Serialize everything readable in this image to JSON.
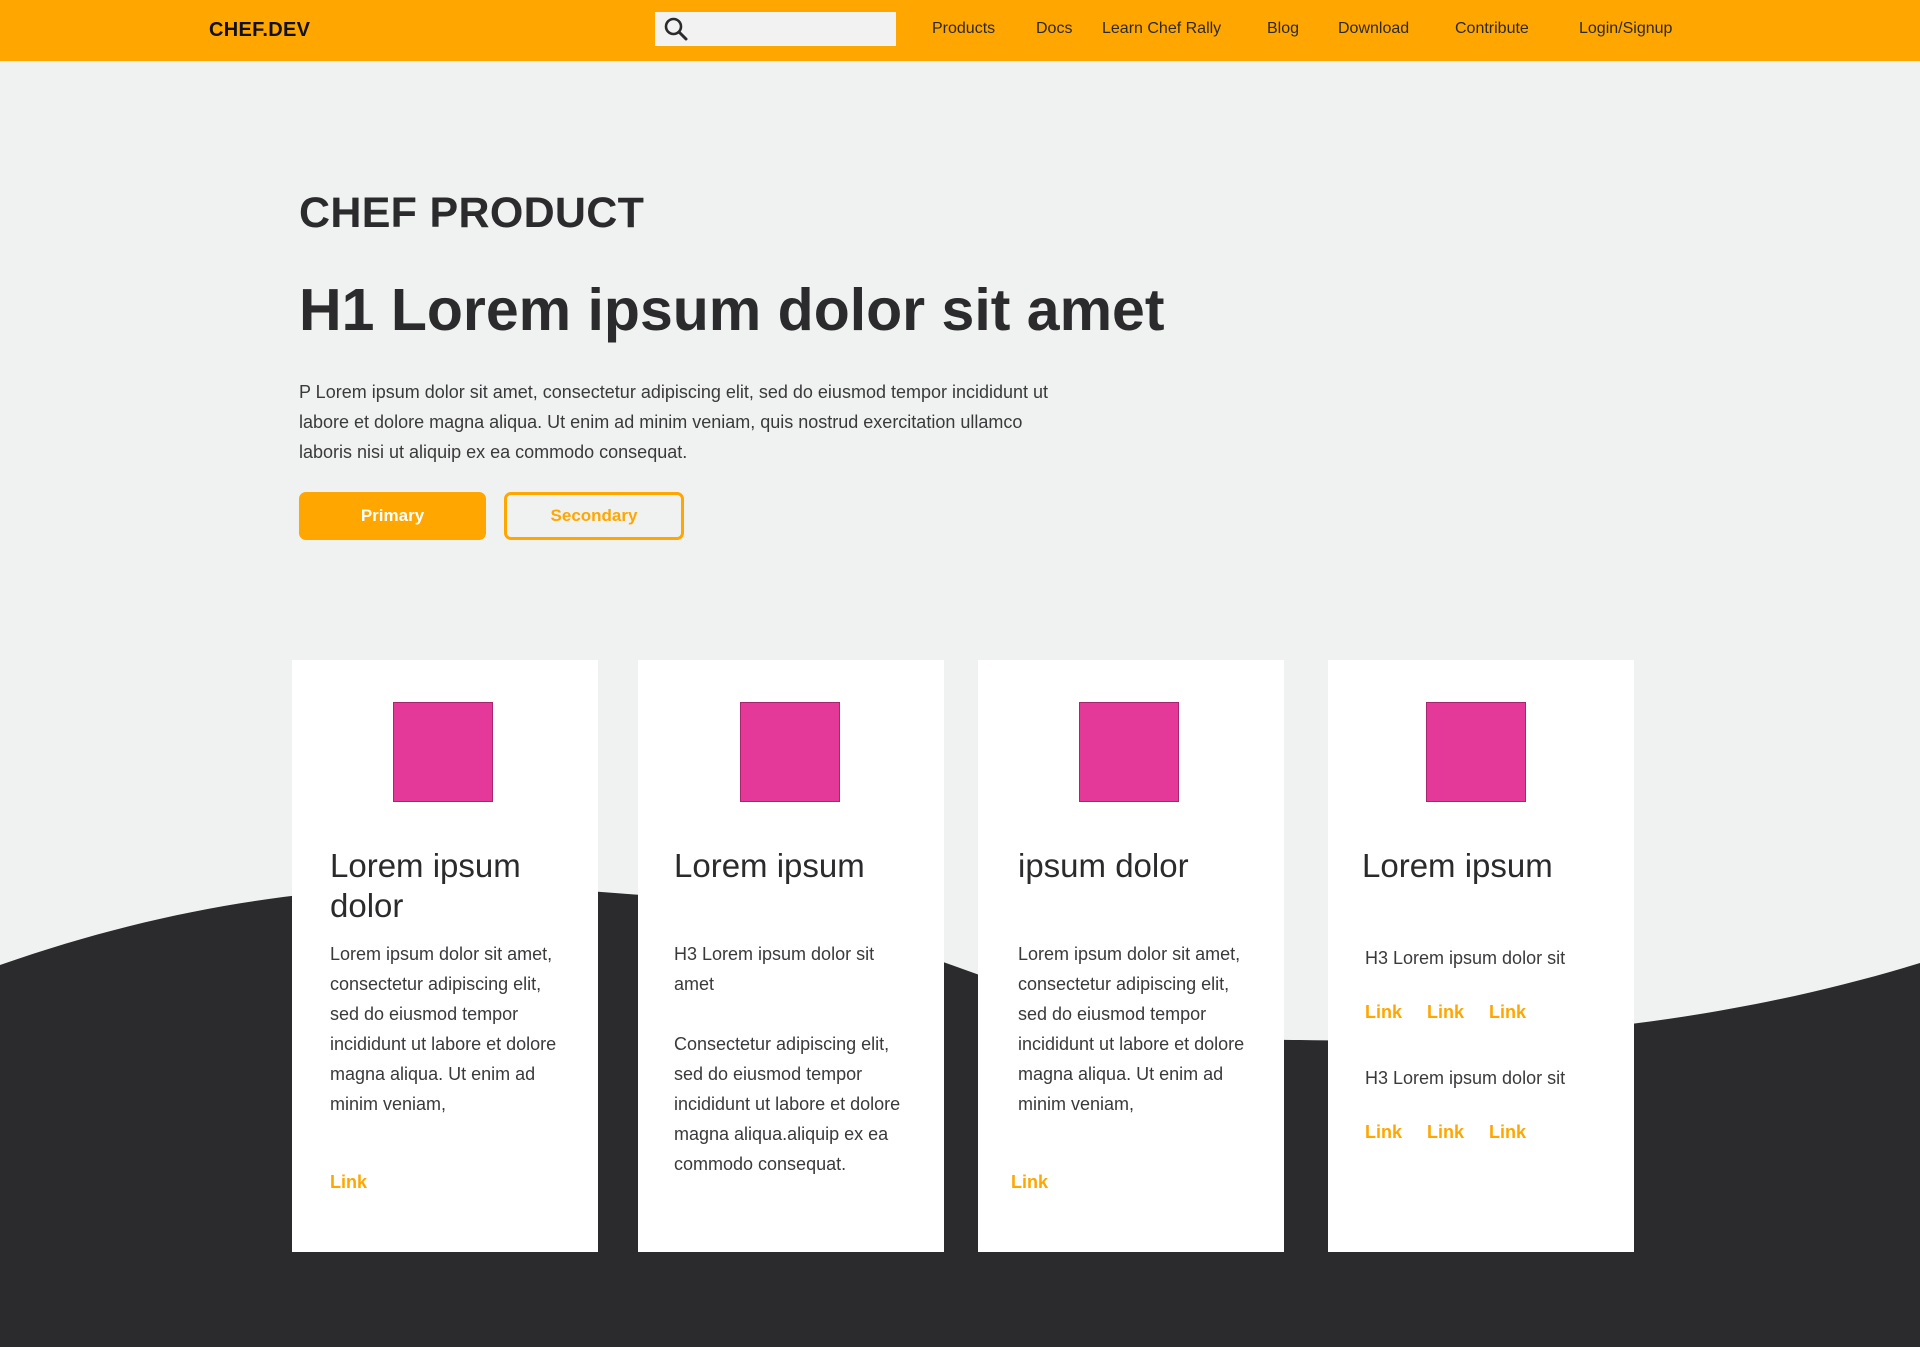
{
  "header": {
    "logo": "CHEF.DEV",
    "search": {
      "value": "",
      "icon": "search-icon"
    },
    "nav": [
      "Products",
      "Docs",
      "Learn Chef Rally",
      "Blog",
      "Download",
      "Contribute",
      "Login/Signup"
    ]
  },
  "hero": {
    "eyebrow": "CHEF PRODUCT",
    "title": "H1 Lorem ipsum dolor sit amet",
    "text": "P Lorem ipsum dolor sit amet, consectetur adipiscing elit, sed do eiusmod tempor incididunt ut labore et dolore magna aliqua. Ut enim ad minim veniam, quis nostrud exercitation ullamco laboris nisi ut aliquip ex ea commodo consequat.",
    "primary_label": "Primary",
    "secondary_label": "Secondary"
  },
  "cards": [
    {
      "title": "Lorem ipsum dolor",
      "body": "Lorem ipsum dolor sit amet, consectetur adipiscing elit, sed do eiusmod tempor incididunt ut labore et dolore magna aliqua. Ut enim ad minim veniam,",
      "link": "Link"
    },
    {
      "title": "Lorem ipsum",
      "subtitle": "H3 Lorem ipsum dolor sit amet",
      "body": "Consectetur adipiscing elit, sed do eiusmod tempor incididunt ut labore et dolore magna aliqua.aliquip ex ea commodo consequat."
    },
    {
      "title": "ipsum dolor",
      "body": "Lorem ipsum dolor sit amet, consectetur adipiscing elit, sed do eiusmod tempor incididunt ut labore et dolore magna aliqua. Ut enim ad minim veniam,",
      "link": "Link"
    },
    {
      "title": "Lorem ipsum",
      "groups": [
        {
          "heading": "H3 Lorem ipsum dolor sit",
          "links": [
            "Link",
            "Link",
            "Link"
          ]
        },
        {
          "heading": "H3 Lorem ipsum dolor sit",
          "links": [
            "Link",
            "Link",
            "Link"
          ]
        }
      ]
    }
  ],
  "colors": {
    "brand": "#ffa600",
    "background": "#f0f2f1",
    "dark": "#2b2a2c",
    "card_image": "#e5399a"
  }
}
